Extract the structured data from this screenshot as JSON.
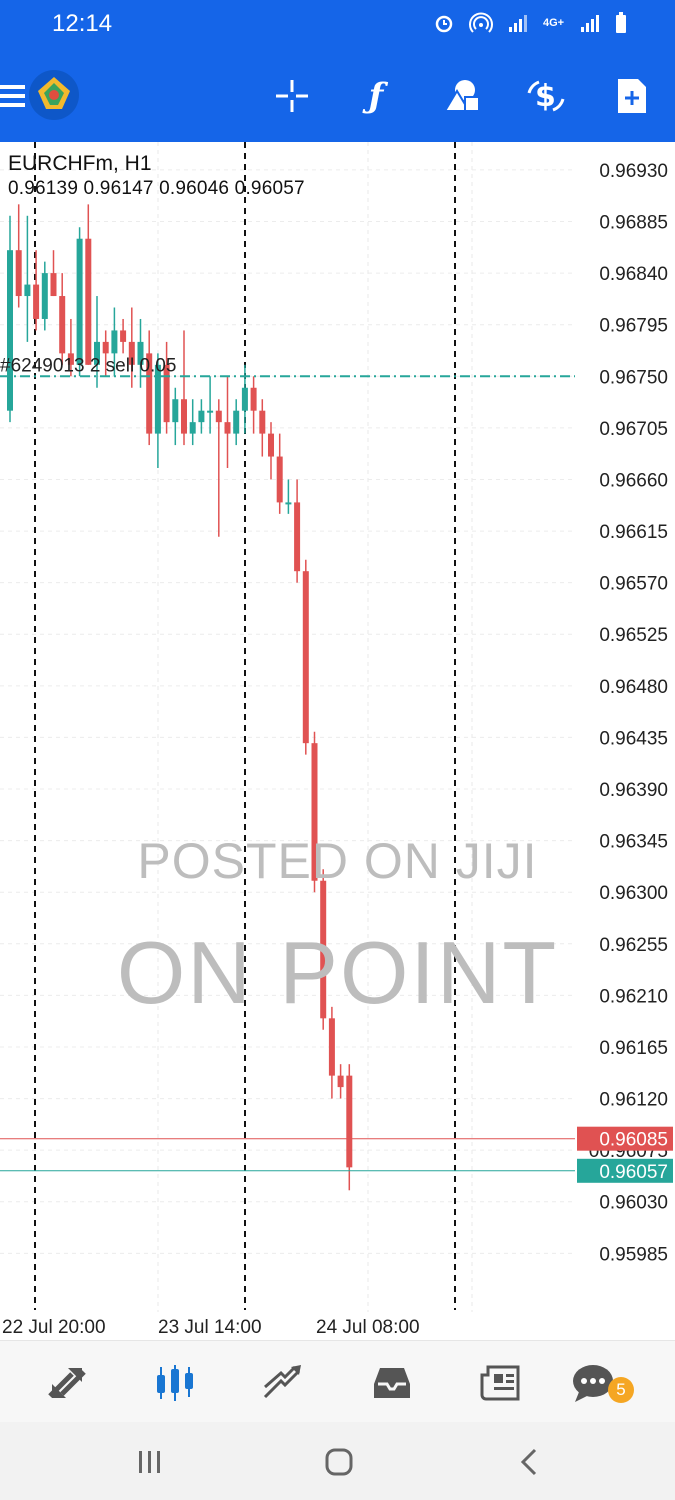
{
  "status_bar": {
    "time": "12:14",
    "network": "4G+"
  },
  "toolbar": {
    "icons": [
      "menu-icon",
      "metatrader-logo",
      "crosshair-icon",
      "indicators-icon",
      "objects-icon",
      "symbols-icon",
      "new-order-icon"
    ]
  },
  "chart": {
    "symbol_title": "EURCHFm, H1",
    "ohlc": "0.96139 0.96147 0.96046 0.96057",
    "order_label": "#6249013 2 sell 0.05",
    "watermark_1": "POSTED ON JIJI",
    "watermark_2": "ON POINT"
  },
  "chart_data": {
    "type": "candlestick",
    "symbol": "EURCHFm",
    "timeframe": "H1",
    "y_ticks": [
      "0.96930",
      "0.96885",
      "0.96840",
      "0.96795",
      "0.96750",
      "0.96705",
      "0.96660",
      "0.96615",
      "0.96570",
      "0.96525",
      "0.96480",
      "0.96435",
      "0.96390",
      "0.96345",
      "0.96300",
      "0.96255",
      "0.96210",
      "0.96165",
      "0.96120",
      "00.96075",
      "0.96030",
      "0.95985"
    ],
    "ylim": [
      0.9596,
      0.9695
    ],
    "x_ticks": [
      "22 Jul 20:00",
      "23 Jul 14:00",
      "24 Jul 08:00"
    ],
    "bid_price": "0.96085",
    "ask_price": "0.96057",
    "order_price": 0.9675,
    "candles": [
      [
        0.9672,
        0.9689,
        0.9671,
        0.9686
      ],
      [
        0.9686,
        0.969,
        0.9681,
        0.9682
      ],
      [
        0.9682,
        0.9689,
        0.9678,
        0.9683
      ],
      [
        0.9683,
        0.9686,
        0.9679,
        0.968
      ],
      [
        0.968,
        0.9685,
        0.9679,
        0.9684
      ],
      [
        0.9684,
        0.9686,
        0.9682,
        0.9682
      ],
      [
        0.9682,
        0.9684,
        0.9676,
        0.9677
      ],
      [
        0.9677,
        0.968,
        0.9675,
        0.9676
      ],
      [
        0.9676,
        0.9688,
        0.9675,
        0.9687
      ],
      [
        0.9687,
        0.969,
        0.9676,
        0.9676
      ],
      [
        0.9676,
        0.9682,
        0.9674,
        0.9678
      ],
      [
        0.9678,
        0.9679,
        0.9675,
        0.9677
      ],
      [
        0.9677,
        0.9681,
        0.9675,
        0.9679
      ],
      [
        0.9679,
        0.968,
        0.9677,
        0.9678
      ],
      [
        0.9678,
        0.9681,
        0.9674,
        0.9676
      ],
      [
        0.9676,
        0.968,
        0.9674,
        0.9678
      ],
      [
        0.9677,
        0.9679,
        0.9669,
        0.967
      ],
      [
        0.967,
        0.9677,
        0.9667,
        0.9676
      ],
      [
        0.9676,
        0.9678,
        0.967,
        0.9671
      ],
      [
        0.9671,
        0.9674,
        0.9669,
        0.9673
      ],
      [
        0.9673,
        0.9679,
        0.9669,
        0.967
      ],
      [
        0.967,
        0.9673,
        0.9669,
        0.9671
      ],
      [
        0.9671,
        0.9673,
        0.967,
        0.9672
      ],
      [
        0.9672,
        0.9675,
        0.967,
        0.9672
      ],
      [
        0.9672,
        0.9673,
        0.9661,
        0.9671
      ],
      [
        0.9671,
        0.9675,
        0.9667,
        0.967
      ],
      [
        0.967,
        0.9673,
        0.9669,
        0.9672
      ],
      [
        0.9672,
        0.9676,
        0.967,
        0.9674
      ],
      [
        0.9674,
        0.9675,
        0.967,
        0.9672
      ],
      [
        0.9672,
        0.9673,
        0.9668,
        0.967
      ],
      [
        0.967,
        0.9671,
        0.9666,
        0.9668
      ],
      [
        0.9668,
        0.967,
        0.9663,
        0.9664
      ],
      [
        0.9664,
        0.9666,
        0.9663,
        0.9664
      ],
      [
        0.9664,
        0.9666,
        0.9657,
        0.9658
      ],
      [
        0.9658,
        0.9659,
        0.9642,
        0.9643
      ],
      [
        0.9643,
        0.9644,
        0.963,
        0.9631
      ],
      [
        0.9631,
        0.9632,
        0.9618,
        0.9619
      ],
      [
        0.9619,
        0.962,
        0.9612,
        0.9614
      ],
      [
        0.9614,
        0.9615,
        0.9612,
        0.9613
      ],
      [
        0.9614,
        0.9615,
        0.9604,
        0.9606
      ]
    ]
  },
  "bottom_nav": {
    "items": [
      "quotes-icon",
      "chart-icon",
      "trade-icon",
      "history-icon",
      "news-icon",
      "chat-icon"
    ],
    "chat_badge": "5"
  }
}
